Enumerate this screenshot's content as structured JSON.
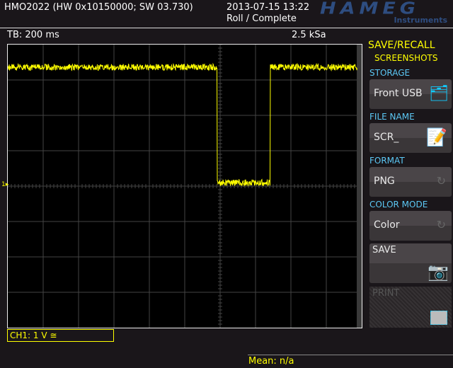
{
  "header": {
    "device": "HMO2022 (HW 0x10150000; SW 03.730)",
    "datetime": "2013-07-15 13:22",
    "mode": "Roll / Complete",
    "logo": "HAMEG",
    "logo_sub": "Instruments"
  },
  "status": {
    "timebase": "TB: 200 ms",
    "sample_rate": "2.5 kSa"
  },
  "menu": {
    "title": "SAVE/RECALL",
    "subtitle": "SCREENSHOTS",
    "storage_label": "STORAGE",
    "storage_value": "Front USB",
    "filename_label": "FILE NAME",
    "filename_value": "SCR_",
    "format_label": "FORMAT",
    "format_value": "PNG",
    "colormode_label": "COLOR MODE",
    "colormode_value": "Color",
    "save_label": "SAVE",
    "print_label": "PRINT"
  },
  "channel": {
    "label": "CH1: 1 V ≅",
    "marker": "1",
    "color": "#ffff00"
  },
  "measure": {
    "mean": "Mean: n/a"
  }
}
